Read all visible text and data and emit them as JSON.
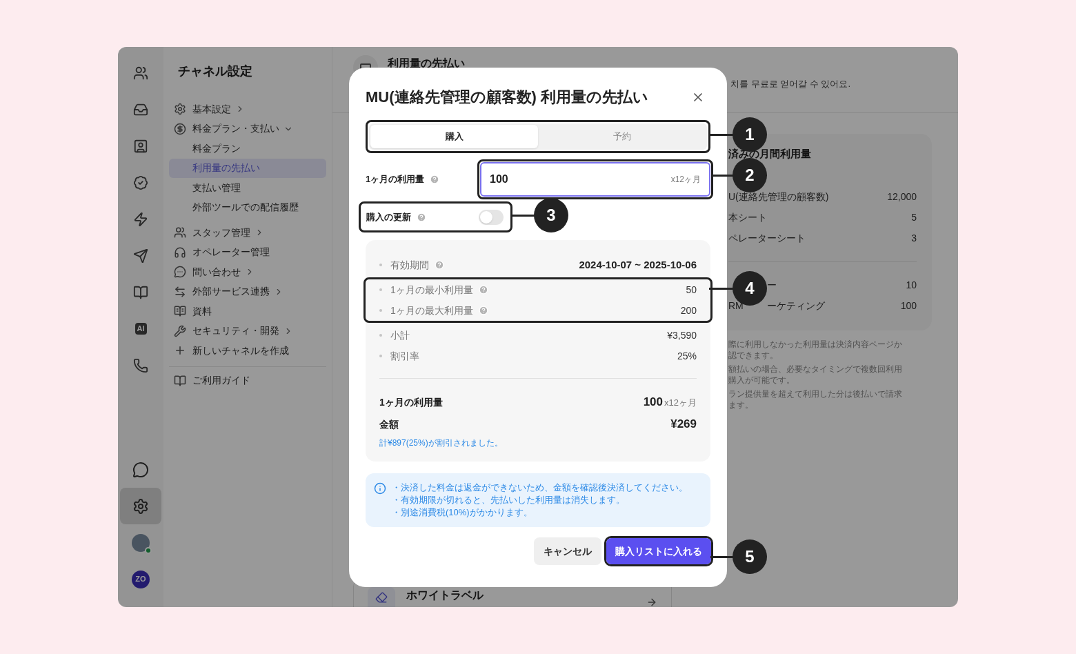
{
  "rail": {
    "items": [
      {
        "selected": false
      },
      {
        "selected": false
      },
      {
        "selected": false
      },
      {
        "selected": false
      },
      {
        "selected": false
      },
      {
        "selected": false
      },
      {
        "selected": false
      },
      {
        "selected": false,
        "label": "AI"
      },
      {
        "selected": false
      }
    ],
    "bottom_items": [
      {
        "selected": false
      },
      {
        "selected": true
      }
    ],
    "avatar": {
      "online": true
    },
    "workspace": {
      "label": "ZO"
    }
  },
  "nav": {
    "title": "チャネル設定",
    "sections": [
      [
        {
          "label": "基本設定",
          "expanded": false,
          "selected": false
        },
        {
          "label": "料金プラン・支払い",
          "expanded": true,
          "selected": false,
          "children": [
            {
              "label": "料金プラン",
              "selected": false
            },
            {
              "label": "利用量の先払い",
              "selected": true
            },
            {
              "label": "支払い管理",
              "selected": false
            },
            {
              "label": "外部ツールでの配信履歴",
              "selected": false
            }
          ]
        }
      ],
      [
        {
          "label": "スタッフ管理",
          "expanded": false,
          "selected": false
        },
        {
          "label": "オペレーター管理",
          "selected": false
        },
        {
          "label": "問い合わせ",
          "expanded": false,
          "selected": false
        },
        {
          "label": "外部サービス連携",
          "expanded": false,
          "selected": false
        },
        {
          "label": "資料",
          "selected": false
        },
        {
          "label": "セキュリティ・開発",
          "expanded": false,
          "selected": false
        },
        {
          "label": "新しいチャネルを作成",
          "selected": false
        }
      ]
    ],
    "footer_items": [
      {
        "label": "ご利用ガイド",
        "selected": false
      }
    ]
  },
  "page": {
    "title": "利用量の先払い",
    "subtitle": "치를 무료로 얻어갈 수 있어요.",
    "usage_card": {
      "title": "済みの月間利用量",
      "rows": [
        {
          "label": "U(連絡先管理の顧客数)",
          "value": "12,000"
        },
        {
          "label": "本シート",
          "value": "5"
        },
        {
          "label": "ペレーターシート",
          "value": "3"
        }
      ],
      "extra_rows": [
        {
          "label_after": "ー",
          "value": "10"
        },
        {
          "label": "RM",
          "label_after": "ーケティング",
          "value": "100"
        }
      ]
    },
    "notes": [
      [
        "際に利用しなかった利用量は決済内容ページか",
        "認できます。"
      ],
      [
        "額払いの場合、必要なタイミングで複数回利用",
        "購入が可能です。"
      ],
      [
        "ラン提供量を超えて利用した分は後払いで請求",
        "ます。"
      ]
    ],
    "feature_card": {
      "title": "ホワイトラベル"
    }
  },
  "modal": {
    "title": "MU(連絡先管理の顧客数) 利用量の先払い",
    "tabs": {
      "outlined": true,
      "items": [
        {
          "label": "購入",
          "selected": true
        },
        {
          "label": "予約",
          "selected": false
        }
      ]
    },
    "usage_field": {
      "outlined": true,
      "label": "1ヶ月の利用量",
      "value": "100",
      "suffix": "x12ヶ月",
      "focused": true
    },
    "renewal": {
      "outlined": true,
      "label": "購入の更新",
      "on": false
    },
    "summary": {
      "groups": [
        {
          "outlined": false,
          "rows": [
            {
              "label": "有効期間",
              "help": true,
              "value": "2024-10-07 ~ 2025-10-06",
              "bold": true
            }
          ]
        },
        {
          "outlined": true,
          "rows": [
            {
              "label": "1ヶ月の最小利用量",
              "help": true,
              "value": "50",
              "bold": false
            },
            {
              "label": "1ヶ月の最大利用量",
              "help": true,
              "value": "200",
              "bold": false
            }
          ]
        },
        {
          "outlined": false,
          "rows": [
            {
              "label": "小計",
              "help": false,
              "value": "¥3,590",
              "bold": false
            },
            {
              "label": "割引率",
              "help": false,
              "value": "25%",
              "bold": false
            }
          ]
        }
      ],
      "usage_label": "1ヶ月の利用量",
      "usage_value": "100",
      "usage_suffix": "x12ヶ月",
      "amount_label": "金額",
      "amount_value": "¥269",
      "discount_note": "計¥897(25%)が割引されました。"
    },
    "info": [
      "・決済した料金は返金ができないため、金額を確認後決済してください。",
      "・有効期限が切れると、先払いした利用量は消失します。",
      "・別途消費税(10%)がかかります。"
    ],
    "cancel": "キャンセル",
    "submit": {
      "label": "購入リストに入れる",
      "outlined": true
    }
  },
  "callouts": [
    {
      "number": "1"
    },
    {
      "number": "2"
    },
    {
      "number": "3"
    },
    {
      "number": "4"
    },
    {
      "number": "5"
    }
  ]
}
